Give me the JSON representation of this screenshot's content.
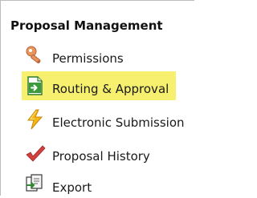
{
  "panel": {
    "title": "Proposal Management",
    "highlight_color": "#f6f06e",
    "items": [
      {
        "label": "Permissions",
        "icon": "key-icon",
        "highlighted": false
      },
      {
        "label": "Routing & Approval",
        "icon": "document-arrow-icon",
        "highlighted": true
      },
      {
        "label": "Electronic Submission",
        "icon": "lightning-icon",
        "highlighted": false
      },
      {
        "label": "Proposal History",
        "icon": "checkmark-icon",
        "highlighted": false
      },
      {
        "label": "Export",
        "icon": "export-document-icon",
        "highlighted": false
      }
    ]
  }
}
